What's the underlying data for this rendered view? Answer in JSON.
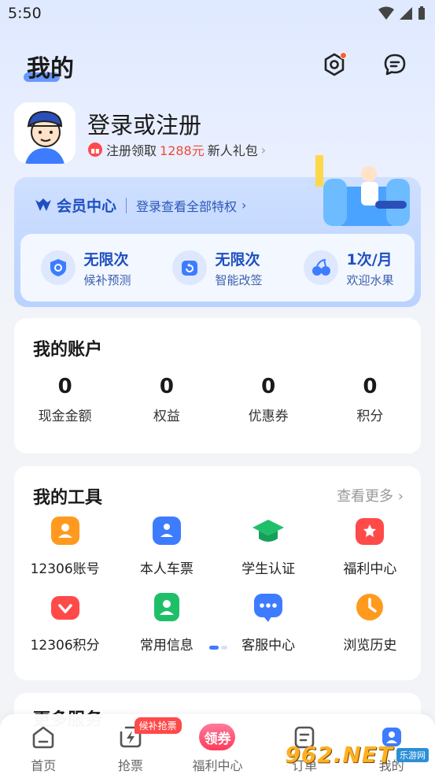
{
  "status_bar": {
    "time": "5:50"
  },
  "header": {
    "title": "我的"
  },
  "profile": {
    "login_title": "登录或注册",
    "gift_prefix": "注册领取",
    "gift_amount": "1288元",
    "gift_suffix": "新人礼包"
  },
  "vip": {
    "title": "会员中心",
    "subtitle": "登录查看全部特权",
    "perks": [
      {
        "title": "无限次",
        "sub": "候补预测",
        "icon": "shield-icon"
      },
      {
        "title": "无限次",
        "sub": "智能改签",
        "icon": "alarm-clock-icon"
      },
      {
        "title": "1次/月",
        "sub": "欢迎水果",
        "icon": "cherry-icon"
      }
    ]
  },
  "account": {
    "title": "我的账户",
    "items": [
      {
        "value": "0",
        "label": "现金金额"
      },
      {
        "value": "0",
        "label": "权益"
      },
      {
        "value": "0",
        "label": "优惠券"
      },
      {
        "value": "0",
        "label": "积分"
      }
    ]
  },
  "tools": {
    "title": "我的工具",
    "more": "查看更多",
    "items": [
      {
        "label": "12306账号",
        "icon": "account-icon",
        "color": "#ff9a1f"
      },
      {
        "label": "本人车票",
        "icon": "ticket-icon",
        "color": "#3d7cff"
      },
      {
        "label": "学生认证",
        "icon": "graduation-cap-icon",
        "color": "#1fbf6a"
      },
      {
        "label": "福利中心",
        "icon": "gift-icon",
        "color": "#ff4a4a"
      },
      {
        "label": "12306积分",
        "icon": "points-icon",
        "color": "#ff4a4a"
      },
      {
        "label": "常用信息",
        "icon": "contact-icon",
        "color": "#1fbf6a"
      },
      {
        "label": "客服中心",
        "icon": "chat-icon",
        "color": "#3d7cff"
      },
      {
        "label": "浏览历史",
        "icon": "clock-icon",
        "color": "#ff9a1f"
      }
    ]
  },
  "next_section": {
    "title": "更多服务"
  },
  "tabbar": {
    "items": [
      {
        "label": "首页",
        "icon": "home-icon"
      },
      {
        "label": "抢票",
        "icon": "lightning-icon"
      },
      {
        "label": "福利中心",
        "icon": "coupon-icon"
      },
      {
        "label": "订单",
        "icon": "order-icon"
      },
      {
        "label": "我的",
        "icon": "profile-icon"
      }
    ],
    "grab_badge": "候补抢票",
    "coupon_text": "领券"
  },
  "watermark": {
    "text": "962.NET",
    "sub": "乐游网"
  }
}
